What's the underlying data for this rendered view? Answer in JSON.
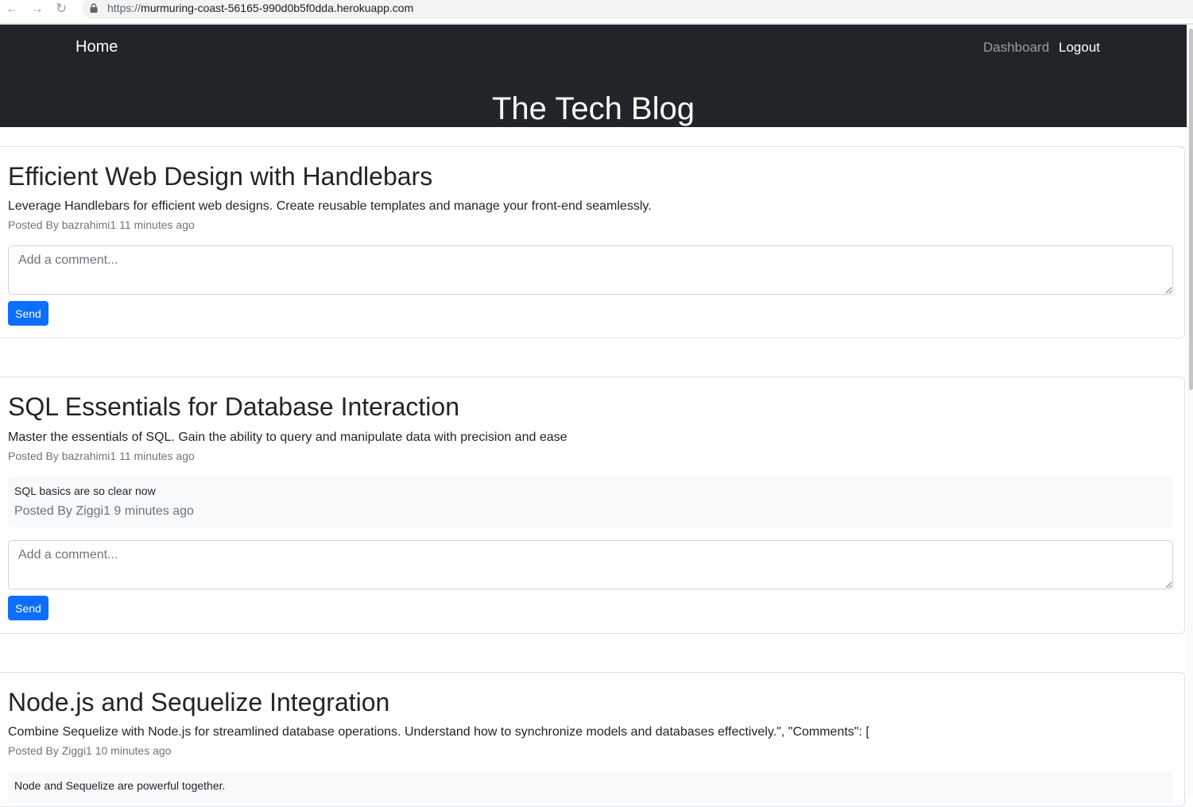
{
  "browser": {
    "url_protocol": "https://",
    "url_host": "murmuring-coast-56165-990d0b5f0dda.herokuapp.com",
    "back_icon": "←",
    "forward_icon": "→",
    "reload_icon": "↻"
  },
  "header": {
    "brand": "Home",
    "title": "The Tech Blog",
    "nav": {
      "dashboard": "Dashboard",
      "logout": "Logout"
    }
  },
  "colors": {
    "header_bg": "#212529",
    "primary": "#0d6efd",
    "muted": "#6c757d"
  },
  "posts": [
    {
      "title": "Efficient Web Design with Handlebars",
      "body": "Leverage Handlebars for efficient web designs. Create reusable templates and manage your front-end seamlessly.",
      "meta": "Posted By bazrahimi1 11 minutes ago",
      "comments": [],
      "comment_placeholder": "Add a comment...",
      "send_label": "Send"
    },
    {
      "title": "SQL Essentials for Database Interaction",
      "body": "Master the essentials of SQL. Gain the ability to query and manipulate data with precision and ease",
      "meta": "Posted By bazrahimi1 11 minutes ago",
      "comments": [
        {
          "text": "SQL basics are so clear now",
          "meta": "Posted By Ziggi1 9 minutes ago"
        }
      ],
      "comment_placeholder": "Add a comment...",
      "send_label": "Send"
    },
    {
      "title": "Node.js and Sequelize Integration",
      "body": "Combine Sequelize with Node.js for streamlined database operations. Understand how to synchronize models and databases effectively.\", \"Comments\": [",
      "meta": "Posted By Ziggi1 10 minutes ago",
      "comments": [
        {
          "text": "Node and Sequelize are powerful together."
        }
      ]
    }
  ]
}
